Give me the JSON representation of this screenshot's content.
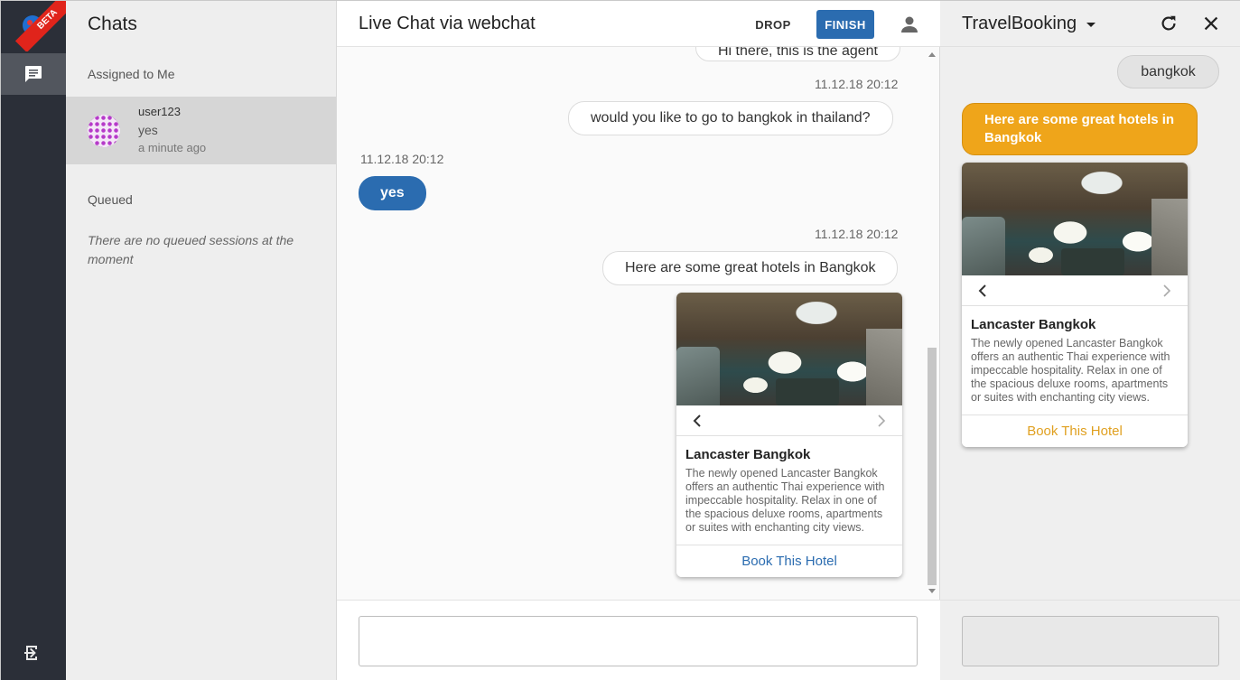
{
  "rail": {
    "beta_label": "BETA"
  },
  "chats_panel": {
    "title": "Chats",
    "assigned_heading": "Assigned to Me",
    "assigned_items": [
      {
        "name": "user123",
        "last_message": "yes",
        "time": "a minute ago"
      }
    ],
    "queued_heading": "Queued",
    "queued_empty": "There are no queued sessions at the moment"
  },
  "main": {
    "title": "Live Chat via webchat",
    "drop_label": "DROP",
    "finish_label": "FINISH",
    "top_cut_message": "Hi there, this is the agent",
    "messages": {
      "m1_time": "11.12.18 20:12",
      "m1_text": "would you like to go to bangkok in thailand?",
      "m2_time": "11.12.18 20:12",
      "m2_text": "yes",
      "m3_time": "11.12.18 20:12",
      "m3_text": "Here are some great hotels in Bangkok"
    },
    "card": {
      "title": "Lancaster Bangkok",
      "description": "The newly opened Lancaster Bangkok offers an authentic Thai experience with impeccable hospitality. Relax in one of the spacious deluxe rooms, apartments or suites with enchanting city views.",
      "button": "Book This Hotel"
    },
    "composer_placeholder": ""
  },
  "right_panel": {
    "title": "TravelBooking",
    "user_message": "bangkok",
    "bot_message": "Here are some great hotels in Bangkok",
    "card": {
      "title": "Lancaster Bangkok",
      "description": "The newly opened Lancaster Bangkok offers an authentic Thai experience with impeccable hospitality. Relax in one of the spacious deluxe rooms, apartments or suites with enchanting city views.",
      "button": "Book This Hotel"
    },
    "composer_placeholder": ""
  },
  "colors": {
    "rail_bg": "#2b2f38",
    "agent_blue": "#2b6cb0",
    "bot_orange": "#efa51a",
    "right_card_button": "#e0a020"
  }
}
